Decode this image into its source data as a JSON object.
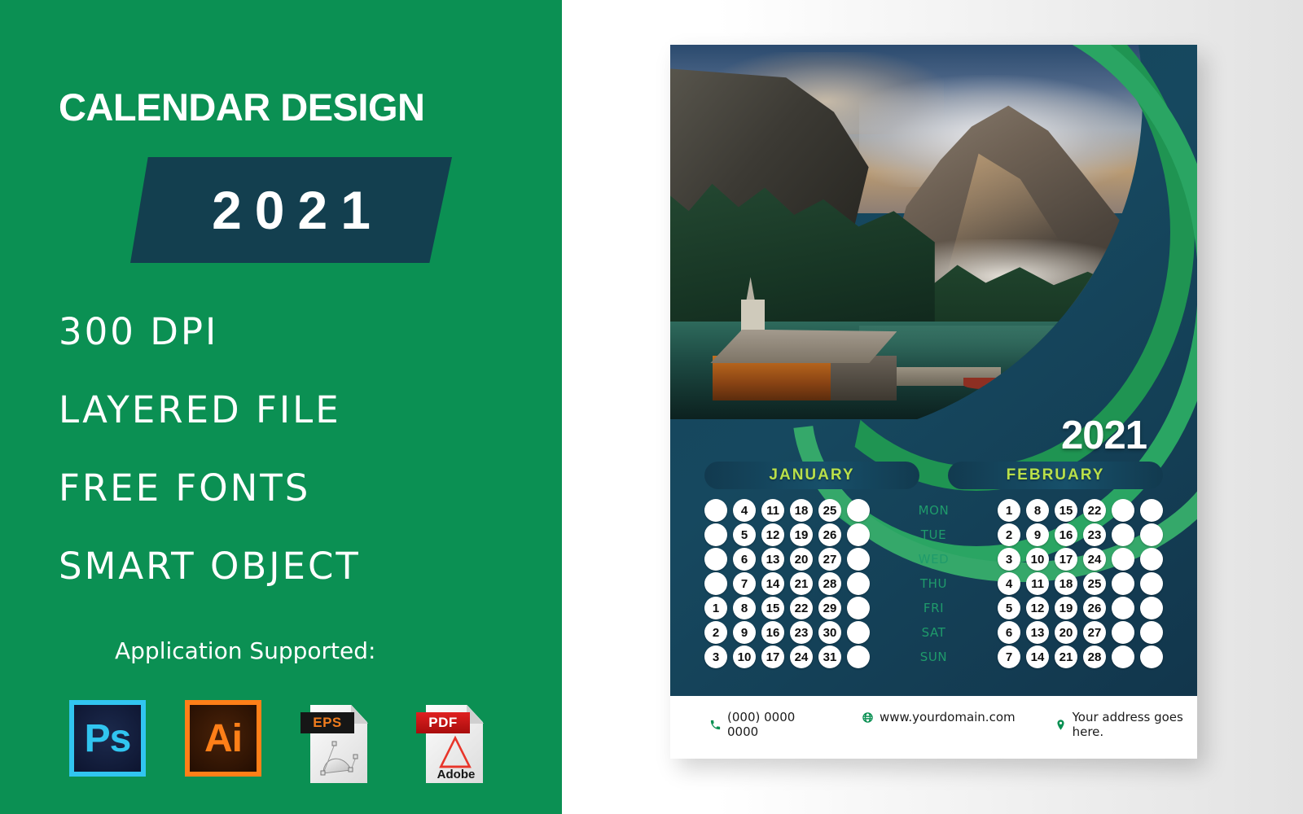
{
  "left_panel": {
    "headline": "CALENDAR DESIGN",
    "year_ribbon": "2021",
    "features": [
      "300 DPI",
      "LAYERED FILE",
      "FREE FONTS",
      "SMART OBJECT"
    ],
    "app_support_label": "Application Supported:",
    "app_icons": [
      {
        "name": "photoshop-icon",
        "label": "Ps",
        "border_color": "#31c5f0"
      },
      {
        "name": "illustrator-icon",
        "label": "Ai",
        "border_color": "#ff7f18"
      },
      {
        "name": "eps-file-icon",
        "label": "EPS",
        "tag_color": "#161616"
      },
      {
        "name": "pdf-file-icon",
        "label": "PDF",
        "tag_color": "#c01515",
        "brand": "Adobe"
      }
    ],
    "background_color": "#0b9053",
    "ribbon_color": "#133f4f"
  },
  "calendar_card": {
    "year_badge": "2021",
    "photo_alt": "mountain-lake-cabin-photo",
    "accent_green": "#2aa563",
    "body_navy": "#14445c",
    "month_label_color": "#b9e04a",
    "weekday_color": "#1f9b6b",
    "weekdays": [
      "MON",
      "TUE",
      "WED",
      "THU",
      "FRI",
      "SAT",
      "SUN"
    ],
    "months": [
      {
        "name": "JANUARY",
        "columns": 6,
        "rows": [
          [
            "",
            "4",
            "11",
            "18",
            "25",
            ""
          ],
          [
            "",
            "5",
            "12",
            "19",
            "26",
            ""
          ],
          [
            "",
            "6",
            "13",
            "20",
            "27",
            ""
          ],
          [
            "",
            "7",
            "14",
            "21",
            "28",
            ""
          ],
          [
            "1",
            "8",
            "15",
            "22",
            "29",
            ""
          ],
          [
            "2",
            "9",
            "16",
            "23",
            "30",
            ""
          ],
          [
            "3",
            "10",
            "17",
            "24",
            "31",
            ""
          ]
        ]
      },
      {
        "name": "FEBRUARY",
        "columns": 6,
        "rows": [
          [
            "1",
            "8",
            "15",
            "22",
            "",
            ""
          ],
          [
            "2",
            "9",
            "16",
            "23",
            "",
            ""
          ],
          [
            "3",
            "10",
            "17",
            "24",
            "",
            ""
          ],
          [
            "4",
            "11",
            "18",
            "25",
            "",
            ""
          ],
          [
            "5",
            "12",
            "19",
            "26",
            "",
            ""
          ],
          [
            "6",
            "13",
            "20",
            "27",
            "",
            ""
          ],
          [
            "7",
            "14",
            "21",
            "28",
            "",
            ""
          ]
        ]
      }
    ],
    "footer": {
      "phone": "(000) 0000 0000",
      "website": "www.yourdomain.com",
      "address": "Your address goes here.",
      "phone_icon": "phone-icon",
      "web_icon": "globe-icon",
      "address_icon": "map-pin-icon"
    }
  }
}
